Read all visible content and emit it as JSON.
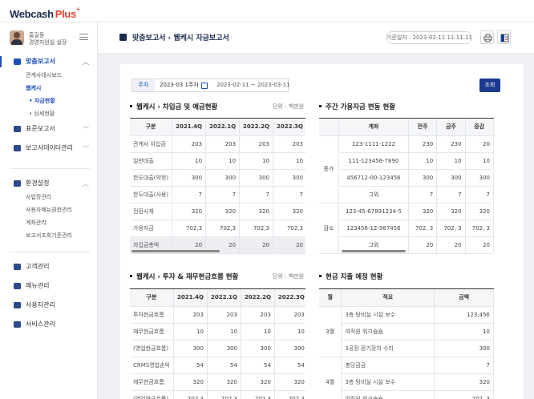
{
  "app": {
    "logo_main": "Webcash",
    "logo_plus": "Plus",
    "logo_sup": "+"
  },
  "profile": {
    "name": "홍길동",
    "role": "경영지원실 실장"
  },
  "sidebar": {
    "groups": [
      {
        "label": "맞춤보고서",
        "subs": [
          {
            "label": "관계사대시보드"
          },
          {
            "label": "웹케시"
          },
          {
            "label": "자금현황"
          },
          {
            "label": "상세현황"
          }
        ]
      },
      {
        "label": "표준보고서"
      },
      {
        "label": "보고서데이터관리"
      },
      {
        "label": "환경설정",
        "subs": [
          {
            "label": "사업장관리"
          },
          {
            "label": "사용자메뉴권한관리"
          },
          {
            "label": "계좌관리"
          },
          {
            "label": "보고서조회기준관리"
          }
        ]
      },
      {
        "label": "고객관리"
      },
      {
        "label": "메뉴관리"
      },
      {
        "label": "사용자관리"
      },
      {
        "label": "서비스관리"
      }
    ]
  },
  "header": {
    "breadcrumb": "맞춤보고서 › 웹케시 자금보고서",
    "std_date": "기준일자 : 2023-02-11 11:11:11"
  },
  "filter": {
    "label": "주차",
    "value": "2023-03 1주차",
    "range": "2023-02-11 ~ 2023-03-11",
    "search": "조회"
  },
  "sec1": {
    "title": "웹케시 › 차입금 및 예금현황",
    "unit": "단위 : 백만원",
    "headers": [
      "구분",
      "2021.4Q",
      "2022.1Q",
      "2022.2Q",
      "2022.3Q"
    ],
    "rows": [
      [
        "관계사 차입금",
        "203",
        "203",
        "203",
        "203"
      ],
      [
        "일반대출",
        "10",
        "10",
        "10",
        "10"
      ],
      [
        "한도대출(약정)",
        "300",
        "300",
        "300",
        "300"
      ],
      [
        "한도대출(사용)",
        "7",
        "7",
        "7",
        "7"
      ],
      [
        "전환사채",
        "320",
        "320",
        "320",
        "320"
      ],
      [
        "가용자금",
        "702,3",
        "702,3",
        "702,3",
        "702,3"
      ],
      [
        "차입금총액",
        "20",
        "20",
        "20",
        "20"
      ]
    ]
  },
  "sec2": {
    "title": "주간 가용자금 변동 현황",
    "headers": [
      "계좌",
      "전주",
      "금주",
      "증감"
    ],
    "groups": [
      {
        "label": "증가",
        "rows": [
          [
            "123-1111-1222",
            "230",
            "230",
            "20"
          ],
          [
            "111-123456-7890",
            "10",
            "10",
            "10"
          ],
          [
            "456712-00-123456",
            "300",
            "300",
            "300"
          ],
          [
            "그외",
            "7",
            "7",
            "7"
          ]
        ]
      },
      {
        "label": "감소",
        "rows": [
          [
            "123-45-67891234-5",
            "320",
            "320",
            "320"
          ],
          [
            "123456-12-987456",
            "702, 3",
            "702, 3",
            "702, 3"
          ],
          [
            "그외",
            "20",
            "20",
            "20"
          ]
        ]
      }
    ]
  },
  "sec3": {
    "title": "웹케시 › 투자 & 재무현금흐름 현황",
    "unit": "단위 : 백만원",
    "headers": [
      "구분",
      "2021.4Q",
      "2022.1Q",
      "2022.2Q",
      "2022.3Q"
    ],
    "rows": [
      [
        "투자현금흐름",
        "203",
        "203",
        "203",
        "203"
      ],
      [
        "재무현금흐름",
        "10",
        "10",
        "10",
        "10"
      ],
      [
        "(영업현금흐름)",
        "300",
        "300",
        "300",
        "300"
      ],
      [
        "CRMS영업손익",
        "54",
        "54",
        "54",
        "54"
      ],
      [
        "재무현금흐름",
        "320",
        "320",
        "320",
        "320"
      ],
      [
        "(영업현금흐름)",
        "702,3",
        "702,3",
        "702,3",
        "702,3"
      ]
    ]
  },
  "sec4": {
    "title": "현금 지출 예정 현황",
    "headers": [
      "월",
      "적요",
      "금액"
    ],
    "groups": [
      {
        "label": "3월",
        "rows": [
          [
            "3층 탕비실 시설 보수",
            "123,456"
          ],
          [
            "여직원 워크숍숍",
            "10"
          ],
          [
            "3공장 환기장치 수리",
            "300"
          ]
        ]
      },
      {
        "label": "4월",
        "rows": [
          [
            "충당금금",
            "7"
          ],
          [
            "3층 탕비실 시설 보수",
            "320"
          ],
          [
            "여직원 워크숍숍",
            "702, 3"
          ]
        ]
      }
    ]
  }
}
